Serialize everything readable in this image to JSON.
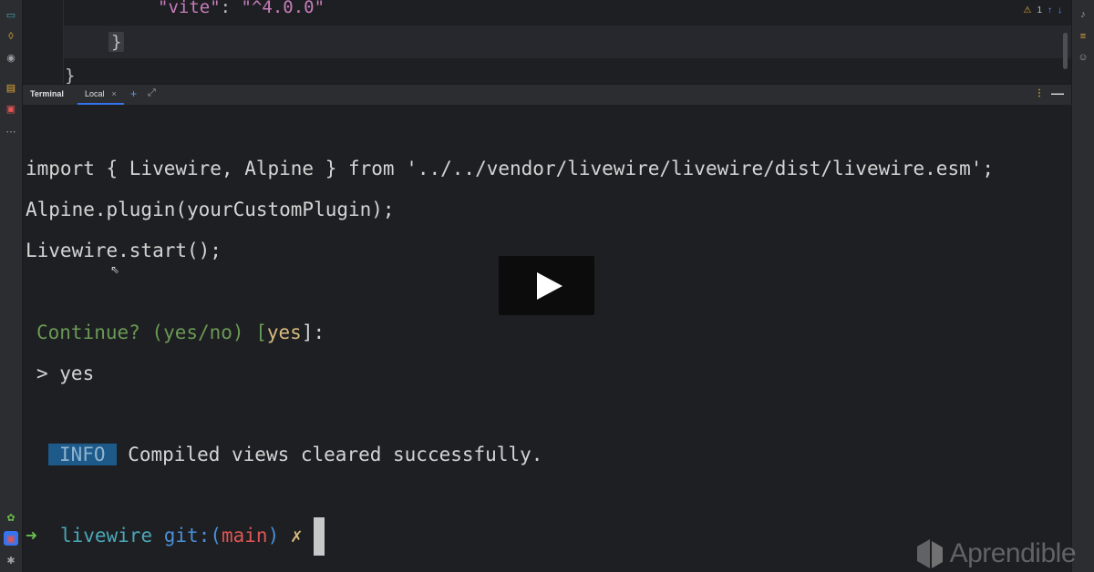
{
  "editor": {
    "line1_key": "\"vite\"",
    "line1_sep": ": ",
    "line1_val": "\"^4.0.0\"",
    "line2": "}",
    "line3": "}",
    "warning_count": "1"
  },
  "tabs": {
    "title": "Terminal",
    "local": "Local",
    "close": "×",
    "plus": "+",
    "expand": "⤢",
    "menu": "⋮",
    "minimize": "—"
  },
  "terminal": {
    "lines": [
      "import { Livewire, Alpine } from '../../vendor/livewire/livewire/dist/livewire.esm';",
      "Alpine.plugin(yourCustomPlugin);",
      "Livewire.start();"
    ],
    "prompt_question": "Continue? (yes/no) [",
    "prompt_default": "yes",
    "prompt_end": "]:",
    "answer": "> yes",
    "info_badge": "INFO",
    "info_message": "Compiled views cleared successfully.",
    "shell_arrow": "➜",
    "shell_dir": "livewire",
    "shell_git": "git:(",
    "shell_branch": "main",
    "shell_git_end": ")",
    "shell_dirty": "✗"
  },
  "brand": {
    "name": "Aprendible"
  },
  "colors": {
    "accent": "#3574f0",
    "info_bg": "#1d5a8a",
    "prompt_green": "#6a9955"
  }
}
